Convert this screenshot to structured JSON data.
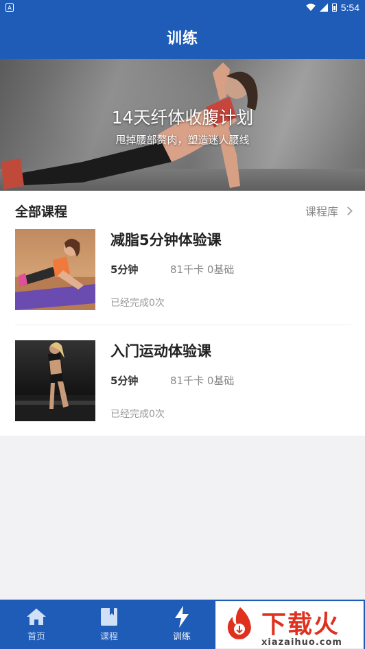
{
  "status_bar": {
    "time": "5:54"
  },
  "app_bar": {
    "title": "训练"
  },
  "banner": {
    "title": "14天纤体收腹计划",
    "subtitle": "甩掉腰部赘肉，塑造迷人腰线"
  },
  "section": {
    "title": "全部课程",
    "library_label": "课程库"
  },
  "courses": [
    {
      "name": "减脂5分钟体验课",
      "duration": "5分钟",
      "stats": "81千卡 0基础",
      "progress": "已经完成0次"
    },
    {
      "name": "入门运动体验课",
      "duration": "5分钟",
      "stats": "81千卡 0基础",
      "progress": "已经完成0次"
    }
  ],
  "tabs": [
    {
      "label": "首页",
      "icon": "home-icon"
    },
    {
      "label": "课程",
      "icon": "book-icon"
    },
    {
      "label": "训练",
      "icon": "lightning-icon",
      "active": true
    },
    {
      "label": "",
      "icon": ""
    }
  ],
  "watermark": {
    "text": "下载火",
    "url": "xiazaihuo.com"
  },
  "colors": {
    "primary": "#1f5cb8",
    "background": "#f2f2f4",
    "watermark_red": "#e0301e"
  }
}
